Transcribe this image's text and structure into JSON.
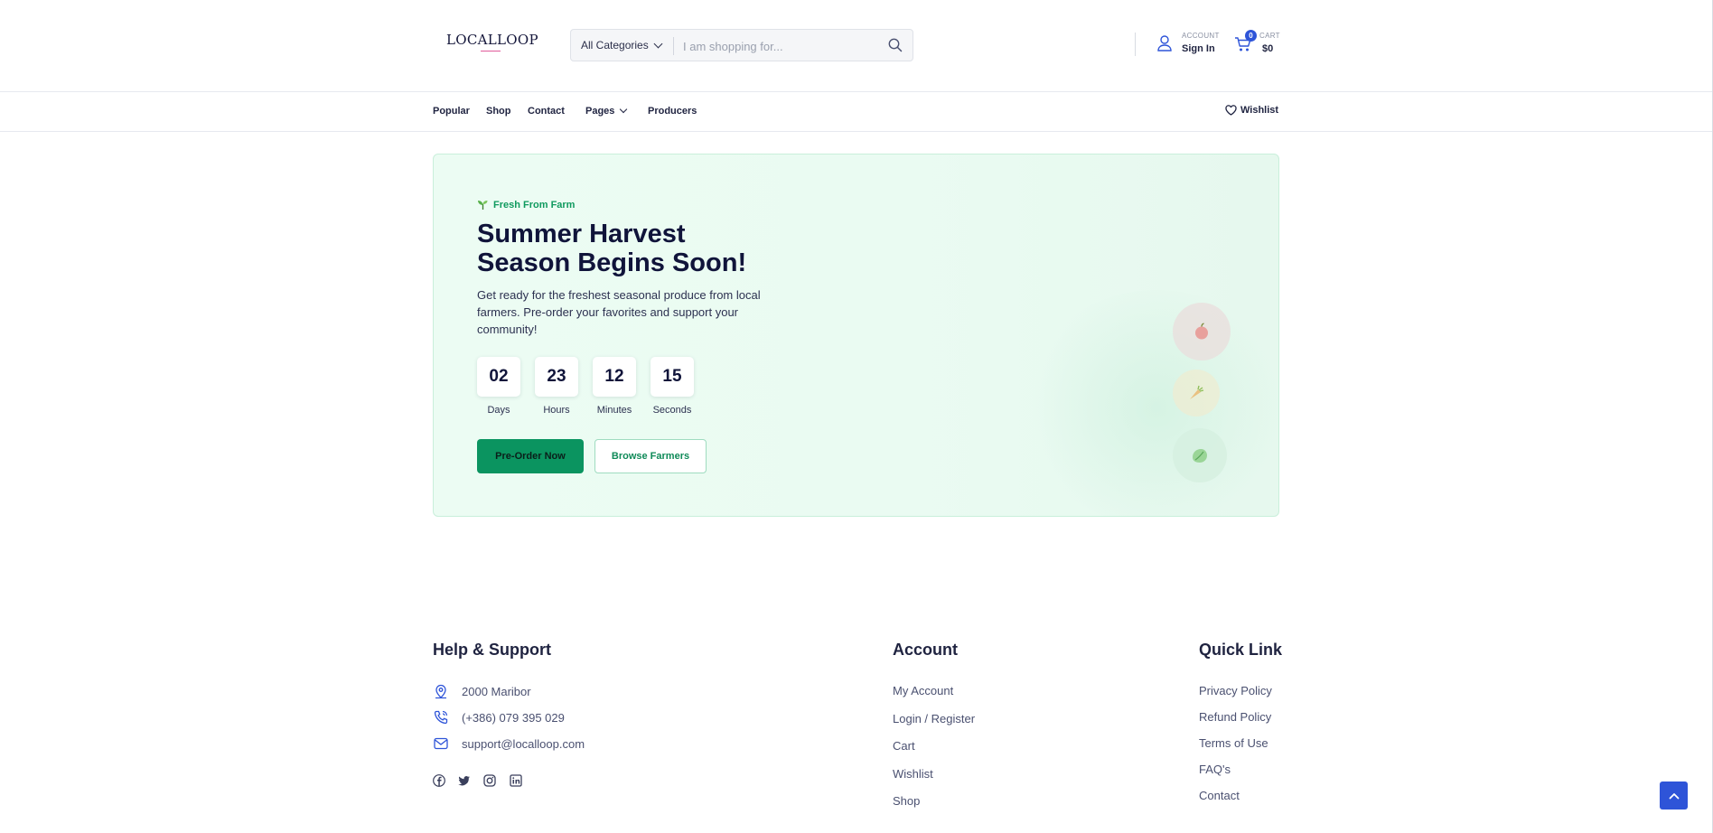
{
  "header": {
    "logo_text": "LOCALLOOP",
    "search": {
      "category_label": "All Categories",
      "placeholder": "I am shopping for..."
    },
    "account": {
      "small_label": "ACCOUNT",
      "main_label": "Sign In"
    },
    "cart": {
      "small_label": "CART",
      "total": "$0",
      "count": "0"
    }
  },
  "nav": {
    "items": [
      "Popular",
      "Shop",
      "Contact",
      "Pages",
      "Producers"
    ],
    "wishlist_label": "Wishlist"
  },
  "hero": {
    "tag": "Fresh From Farm",
    "title_line1": "Summer Harvest",
    "title_line2": "Season Begins Soon!",
    "description": "Get ready for the freshest seasonal produce from local farmers. Pre-order your favorites and support your community!",
    "countdown": [
      {
        "value": "02",
        "label": "Days"
      },
      {
        "value": "23",
        "label": "Hours"
      },
      {
        "value": "12",
        "label": "Minutes"
      },
      {
        "value": "15",
        "label": "Seconds"
      }
    ],
    "primary_button": "Pre-Order Now",
    "secondary_button": "Browse Farmers",
    "decor_icons": [
      "apple-icon",
      "carrot-icon",
      "lettuce-icon"
    ]
  },
  "footer": {
    "help": {
      "heading": "Help & Support",
      "address": "2000 Maribor",
      "phone": "(+386) 079 395 029",
      "email": "support@localloop.com",
      "social_icons": [
        "facebook-icon",
        "twitter-icon",
        "instagram-icon",
        "linkedin-icon"
      ]
    },
    "account": {
      "heading": "Account",
      "links": [
        "My Account",
        "Login / Register",
        "Cart",
        "Wishlist",
        "Shop"
      ]
    },
    "quick": {
      "heading": "Quick Link",
      "links": [
        "Privacy Policy",
        "Refund Policy",
        "Terms of Use",
        "FAQ's",
        "Contact"
      ]
    }
  },
  "colors": {
    "accent_blue": "#2e54d8",
    "accent_green": "#0b9460",
    "hero_bg": "#ecfcf3",
    "text_dark": "#10143a"
  }
}
